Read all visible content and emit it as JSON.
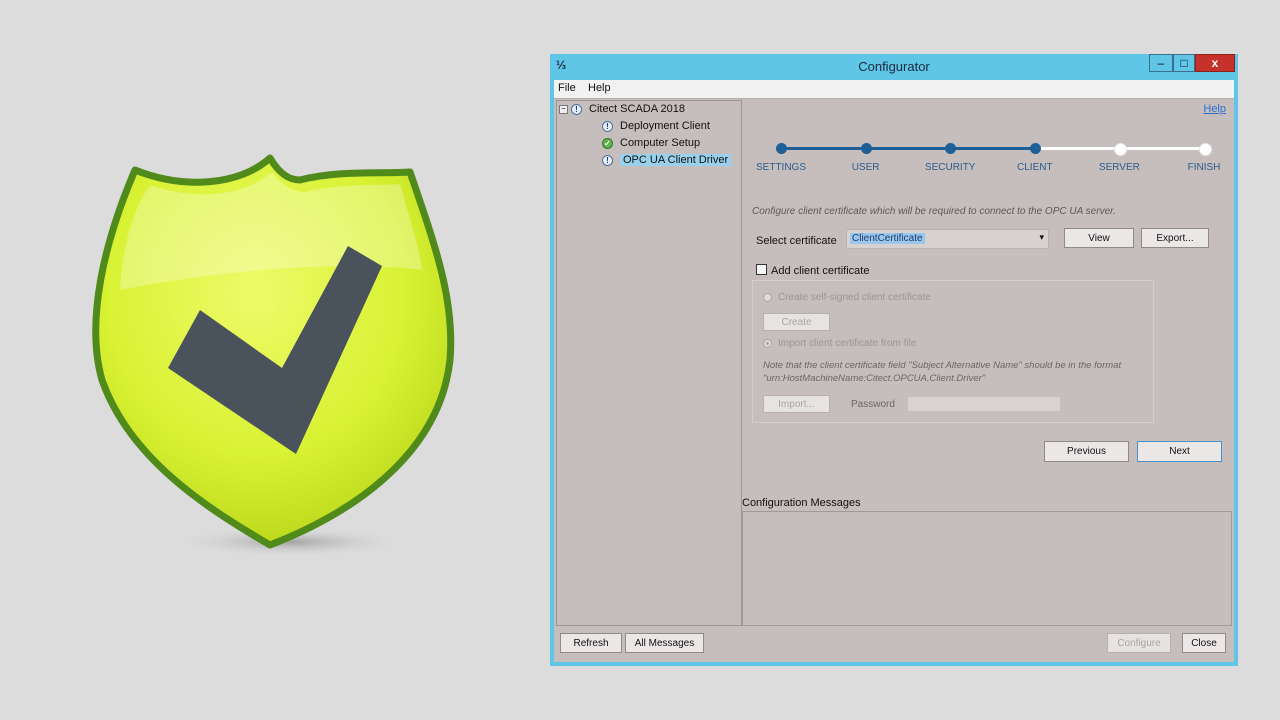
{
  "colors": {
    "accent": "#1e5f97",
    "title_bar": "#5fc6e8",
    "client_bg": "#c6bebd",
    "close_button": "#c7312b",
    "shield_fill": "#d8f233",
    "shield_border": "#4f8a1b",
    "check_mark": "#4a525c"
  },
  "window": {
    "title": "Configurator",
    "icon": "app-icon",
    "min_glyph": "–",
    "max_glyph": "□",
    "close_glyph": "x"
  },
  "menu": {
    "file": "File",
    "help": "Help"
  },
  "tree": {
    "expander": "−",
    "root": "Citect SCADA 2018",
    "items": [
      {
        "label": "Deployment Client",
        "icon": "info-icon",
        "glyph": "!"
      },
      {
        "label": "Computer Setup",
        "icon": "check-icon",
        "glyph": "✓"
      },
      {
        "label": "OPC UA Client Driver",
        "icon": "info-icon",
        "glyph": "!"
      }
    ]
  },
  "main": {
    "help_link": "Help",
    "steps": [
      {
        "label": "SETTINGS",
        "done": true
      },
      {
        "label": "USER",
        "done": true
      },
      {
        "label": "SECURITY",
        "done": true
      },
      {
        "label": "CLIENT",
        "done": true
      },
      {
        "label": "SERVER",
        "done": false
      },
      {
        "label": "FINISH",
        "done": false
      }
    ],
    "instruction": "Configure client certificate which will be required to connect to the OPC UA server.",
    "select_label": "Select certificate",
    "select_value": "ClientCertificate",
    "select_arrow": "▾",
    "view_button": "View",
    "export_button": "Export...",
    "add_cert_label": "Add client certificate",
    "self_signed_label": "Create self-signed client certificate",
    "create_button": "Create",
    "import_label": "Import client certificate from file",
    "note": "Note that the client certificate field \"Subject Alternative Name\" should be in the format \"urn:HostMachineName:Citect.OPCUA.Client.Driver\"",
    "import_button": "Import...",
    "password_label": "Password",
    "previous_button": "Previous",
    "next_button": "Next",
    "messages_title": "Configuration Messages"
  },
  "footer": {
    "refresh_button": "Refresh",
    "all_messages_button": "All Messages",
    "configure_button": "Configure",
    "close_button": "Close"
  }
}
